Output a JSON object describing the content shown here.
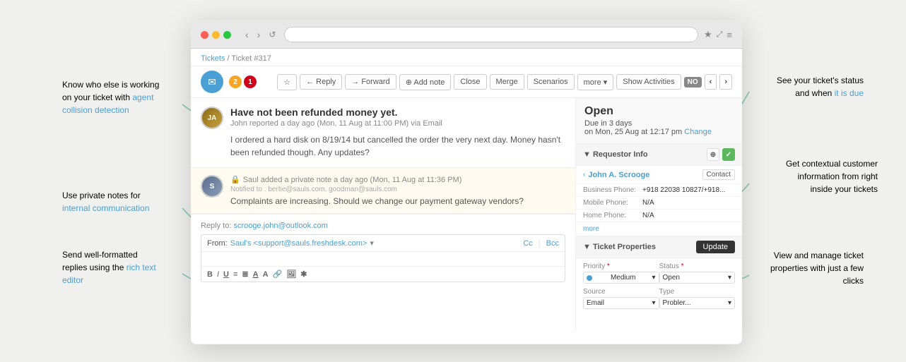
{
  "page": {
    "background": "#f0f0ee"
  },
  "annotations": {
    "left_top": {
      "text": "Know who else is working on your ticket with agent collision detection",
      "highlight_words": "agent collision detection"
    },
    "left_middle": {
      "text": "Use private notes for internal communication",
      "highlight_words": "internal communication"
    },
    "left_bottom": {
      "text": "Send well-formatted replies using the rich text editor",
      "highlight_words": "rich text editor"
    },
    "right_top": {
      "text": "See your ticket's status and when it is due",
      "highlight_words": "it is due"
    },
    "right_bottom_top": {
      "text": "Get contextual customer information from right inside your tickets",
      "highlight_words": ""
    },
    "right_bottom": {
      "text": "View and manage ticket properties with just a few clicks",
      "highlight_words": ""
    }
  },
  "browser": {
    "address": ""
  },
  "breadcrumb": {
    "tickets_label": "Tickets",
    "separator": "/",
    "ticket_label": "Ticket #317"
  },
  "ticket_header": {
    "email_icon": "✉",
    "badge1": "2",
    "badge2": "1",
    "buttons": {
      "star": "☆",
      "reply": "← Reply",
      "forward": "→ Forward",
      "add_note": "⊕ Add note",
      "close": "Close",
      "merge": "Merge",
      "scenarios": "Scenarios",
      "more": "more ▾",
      "show_activities": "Show Activities",
      "no_badge": "NO",
      "arrow_prev": "‹",
      "arrow_next": "›"
    }
  },
  "message": {
    "title": "Have not been refunded money yet.",
    "author": "John",
    "meta": "reported a day ago (Mon, 11 Aug at 11:00 PM) via Email",
    "text": "I ordered a hard disk on 8/19/14 but cancelled the order the very next day. Money hasn't been refunded though. Any updates?"
  },
  "private_note": {
    "agent": "Saul",
    "meta": "added a private note a day ago (Mon, 11 Aug at 11:36 PM)",
    "notified": "Notified to : bertie@sauls.com, goodman@sauls.com",
    "text": "Complaints are increasing. Should we change our payment gateway vendors?"
  },
  "reply_box": {
    "reply_to_label": "Reply to:",
    "reply_to_email": "scrooge.john@outlook.com",
    "from_label": "From:",
    "from_value": "Saul's <support@sauls.freshdesk.com>",
    "cc_label": "Cc",
    "bcc_label": "Bcc"
  },
  "status": {
    "status": "Open",
    "due_label": "Due in 3 days",
    "due_date": "on Mon, 25 Aug at 12:17 pm",
    "change_label": "Change"
  },
  "requestor": {
    "section_title": "▼ Requestor Info",
    "name": "John A. Scrooge",
    "contact_btn": "Contact",
    "business_phone_label": "Business Phone:",
    "business_phone": "+918 22038 10827/+918...",
    "mobile_phone_label": "Mobile Phone:",
    "mobile_phone": "N/A",
    "home_phone_label": "Home Phone:",
    "home_phone": "N/A",
    "more_label": "more"
  },
  "ticket_properties": {
    "section_title": "▼ Ticket Properties",
    "update_btn": "Update",
    "priority_label": "Priority",
    "priority_required": "*",
    "priority_value": "Medium",
    "status_label": "Status",
    "status_required": "*",
    "status_value": "Open",
    "source_label": "Source",
    "source_value": "Email",
    "type_label": "Type",
    "type_value": "Probler..."
  }
}
